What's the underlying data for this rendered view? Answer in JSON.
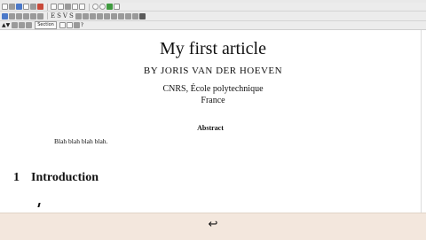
{
  "toolbar": {
    "row3_style_label": "Section"
  },
  "document": {
    "title": "My first article",
    "author_line": "BY JORIS VAN DER HOEVEN",
    "affiliation_line1": "CNRS, École polytechnique",
    "affiliation_line2": "France",
    "abstract_heading": "Abstract",
    "abstract_text": "Blah blah blah blah.",
    "section_number": "1",
    "section_title": "Introduction"
  },
  "bottom_panel": {
    "enter_symbol": "↩"
  },
  "colors": {
    "toolbar_bg": "#ececec",
    "bottom_panel_bg": "#f3e7dd",
    "page_bg": "#ffffff"
  }
}
